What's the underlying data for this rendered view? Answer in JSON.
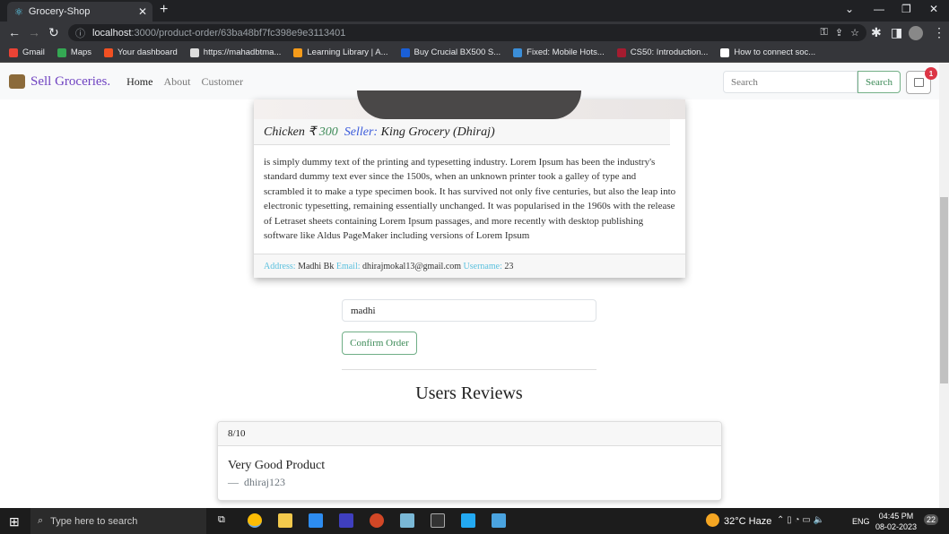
{
  "browser": {
    "tab_title": "Grocery-Shop",
    "url_host": "localhost",
    "url_path": ":3000/product-order/63ba48bf7fc398e9e3113401",
    "bookmarks": [
      {
        "label": "Gmail",
        "color": "#ea4335"
      },
      {
        "label": "Maps",
        "color": "#34a853"
      },
      {
        "label": "Your dashboard",
        "color": "#f25022"
      },
      {
        "label": "https://mahadbtma...",
        "color": "#dddddd"
      },
      {
        "label": "Learning Library | A...",
        "color": "#f59b1a"
      },
      {
        "label": "Buy Crucial BX500 S...",
        "color": "#1a5fd6"
      },
      {
        "label": "Fixed: Mobile Hots...",
        "color": "#3b8ed8"
      },
      {
        "label": "CS50: Introduction...",
        "color": "#a51c30"
      },
      {
        "label": "How to connect soc...",
        "color": "#ffffff"
      }
    ]
  },
  "navbar": {
    "brand": "Sell Groceries.",
    "links": [
      "Home",
      "About",
      "Customer"
    ],
    "search_placeholder": "Search",
    "search_button": "Search",
    "cart_count": "1"
  },
  "product": {
    "name": "Chicken ₹",
    "price": "300",
    "seller_label": "Seller:",
    "seller": "King Grocery (Dhiraj)",
    "description": "is simply dummy text of the printing and typesetting industry. Lorem Ipsum has been the industry's standard dummy text ever since the 1500s, when an unknown printer took a galley of type and scrambled it to make a type specimen book. It has survived not only five centuries, but also the leap into electronic typesetting, remaining essentially unchanged. It was popularised in the 1960s with the release of Letraset sheets containing Lorem Ipsum passages, and more recently with desktop publishing software like Aldus PageMaker including versions of Lorem Ipsum",
    "address_label": "Address:",
    "address": "Madhi Bk",
    "email_label": "Email:",
    "email": "dhirajmokal13@gmail.com",
    "username_label": "Username:",
    "username": "23"
  },
  "order": {
    "address_value": "madhi",
    "confirm_label": "Confirm Order"
  },
  "reviews": {
    "heading": "Users Reviews",
    "items": [
      {
        "rating": "8/10",
        "text": "Very Good Product",
        "dash": "—",
        "author": "dhiraj123"
      }
    ]
  },
  "taskbar": {
    "search_placeholder": "Type here to search",
    "weather": "32°C  Haze",
    "lang": "ENG",
    "time": "04:45 PM",
    "date": "08-02-2023",
    "notifications": "22"
  },
  "colors": {
    "brand": "#6f42c1",
    "success": "#3c8a57",
    "info": "#5bc0de",
    "danger": "#dc3545"
  }
}
